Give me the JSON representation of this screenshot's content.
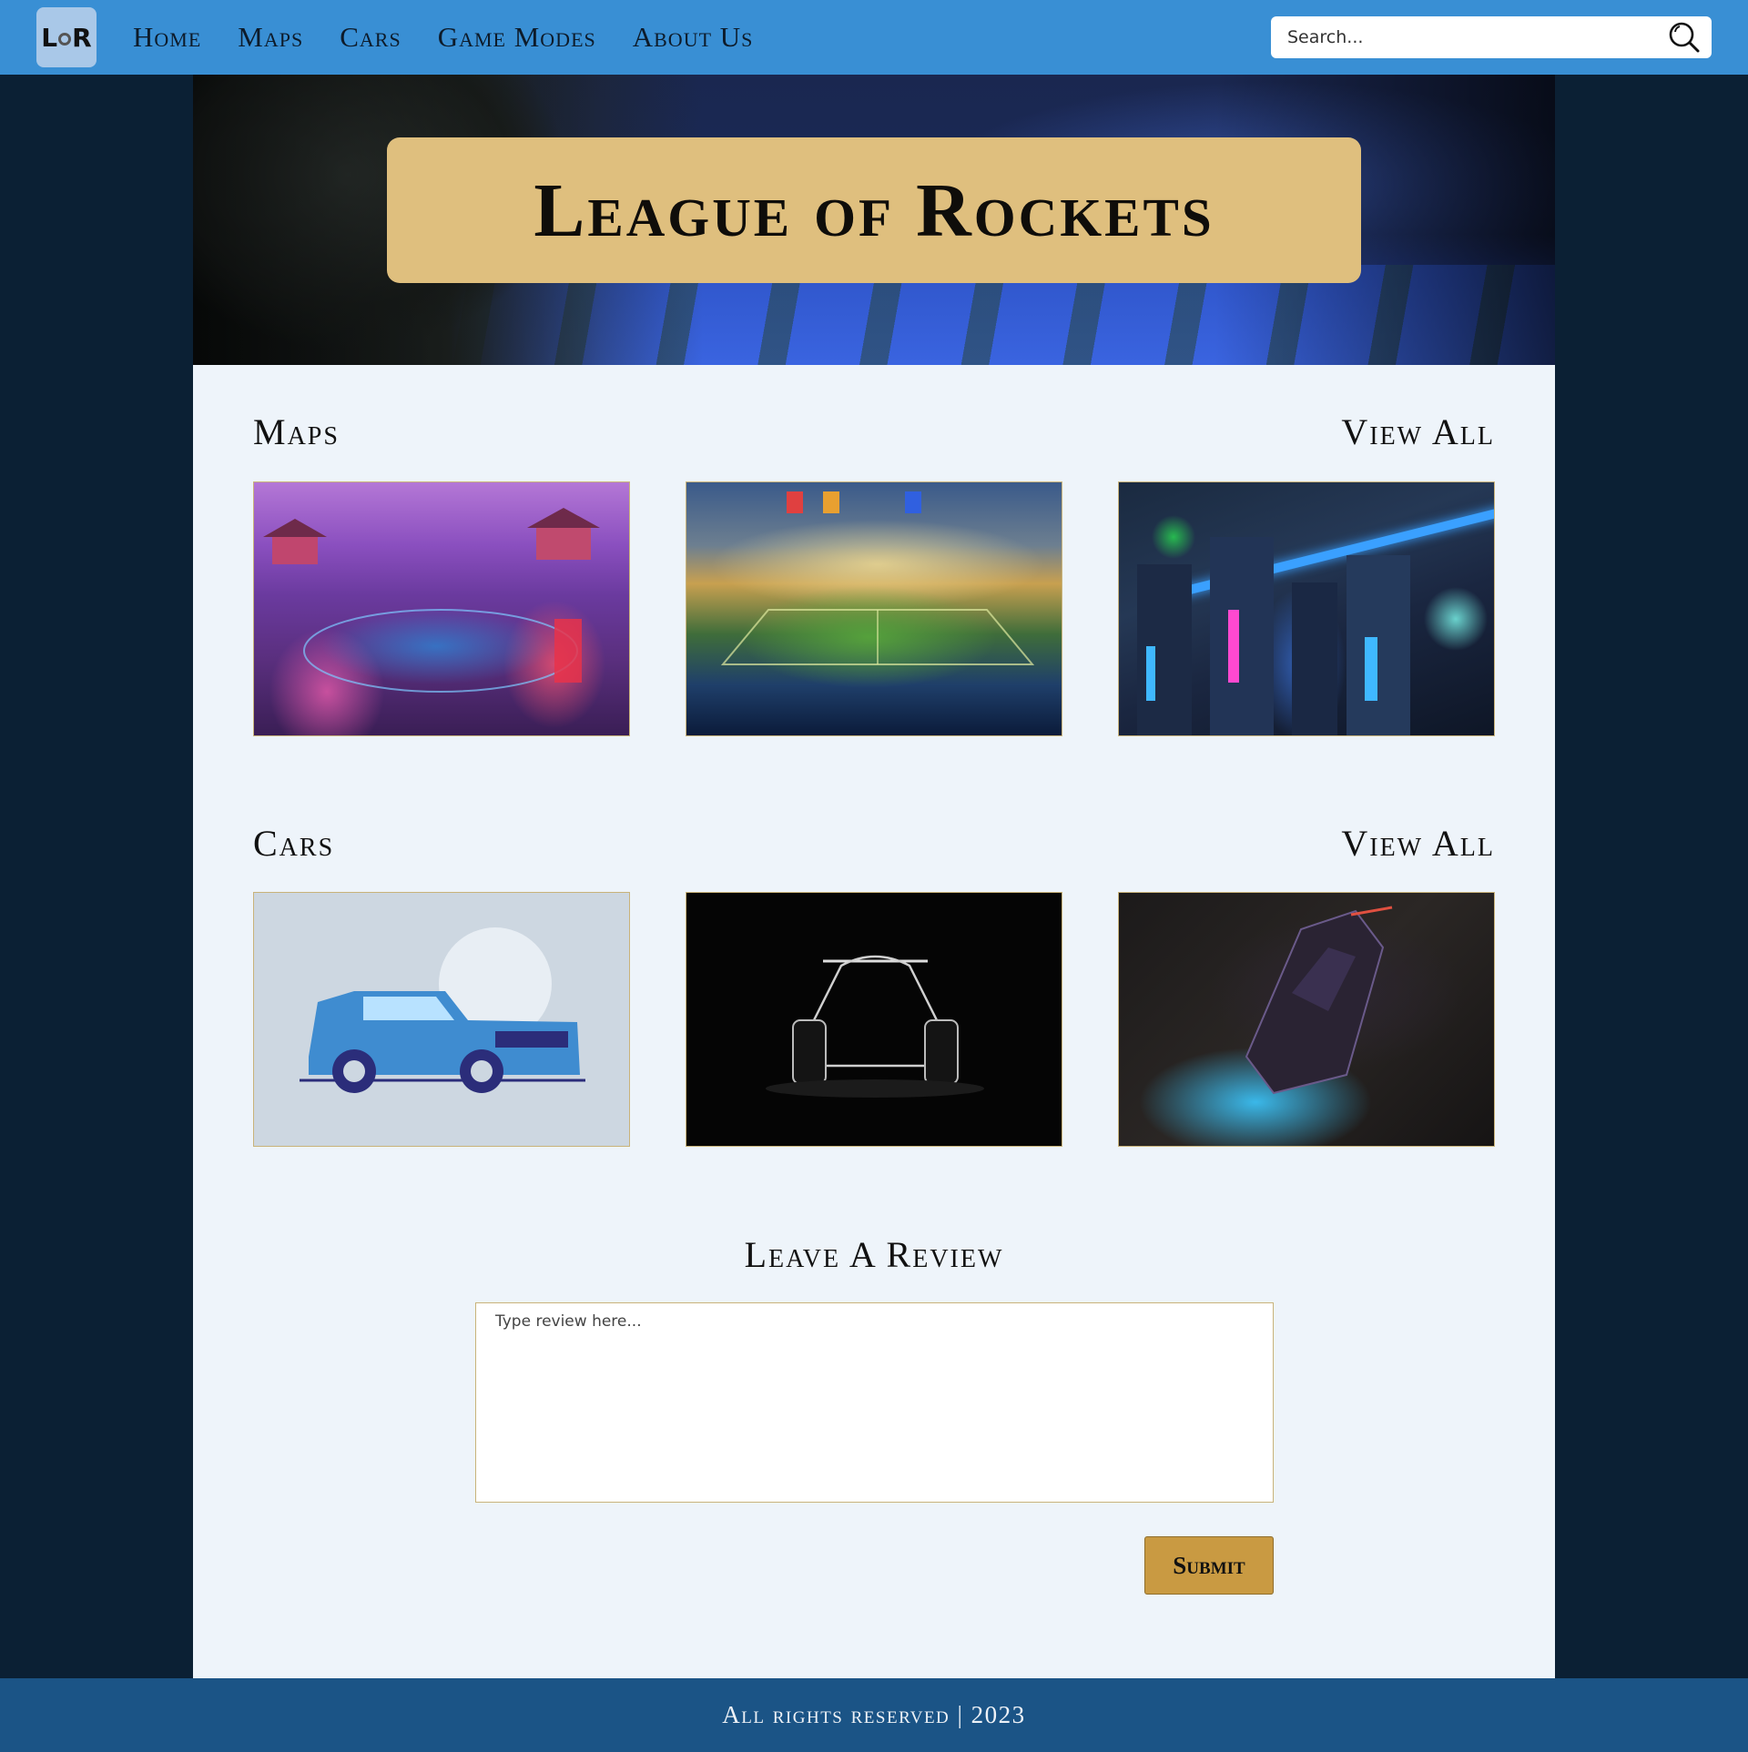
{
  "nav": {
    "logo_text": "LoR",
    "links": [
      "Home",
      "Maps",
      "Cars",
      "Game Modes",
      "About Us"
    ],
    "search_placeholder": "Search..."
  },
  "hero": {
    "title": "League of Rockets"
  },
  "maps": {
    "title": "Maps",
    "view_all": "View All"
  },
  "cars": {
    "title": "Cars",
    "view_all": "View All"
  },
  "review": {
    "title": "Leave A Review",
    "placeholder": "Type review here...",
    "submit_label": "Submit"
  },
  "footer": {
    "text": "All rights reserved | 2023"
  },
  "colors": {
    "navbar": "#398fd4",
    "page_bg": "#0b2034",
    "main_bg": "#eef4fa",
    "hero_title_bg": "#dfbf7e",
    "submit_bg": "#c99a42",
    "footer_bg": "#1b5486"
  }
}
